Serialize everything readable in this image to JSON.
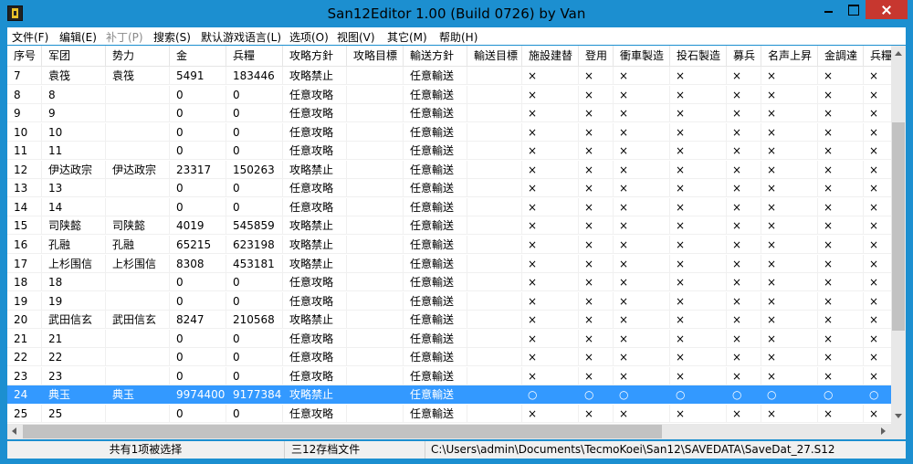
{
  "window": {
    "title": "San12Editor 1.00 (Build 0726) by Van"
  },
  "menu": [
    {
      "label": "文件(F)",
      "enabled": true
    },
    {
      "label": "编辑(E)",
      "enabled": true
    },
    {
      "label": "补丁(P)",
      "enabled": false
    },
    {
      "label": "搜索(S)",
      "enabled": true
    },
    {
      "label": "默认游戏语言(L)",
      "enabled": true
    },
    {
      "label": "选项(O)",
      "enabled": true
    },
    {
      "label": "视图(V)",
      "enabled": true
    },
    {
      "label": "其它(M)",
      "enabled": true
    },
    {
      "label": "帮助(H)",
      "enabled": true
    }
  ],
  "table": {
    "columns": [
      "序号",
      "军团",
      "势力",
      "金",
      "兵糧",
      "攻略方針",
      "攻略目標",
      "輸送方針",
      "輸送目標",
      "施設建替",
      "登用",
      "衝車製造",
      "投石製造",
      "募兵",
      "名声上昇",
      "金調達",
      "兵糧"
    ],
    "selected_row_index": 17,
    "rows": [
      [
        "7",
        "袁筏",
        "袁筏",
        "5491",
        "183446",
        "攻略禁止",
        "",
        "任意輸送",
        "",
        "×",
        "×",
        "×",
        "×",
        "×",
        "×",
        "×",
        "×"
      ],
      [
        "8",
        "8",
        "",
        "0",
        "0",
        "任意攻略",
        "",
        "任意輸送",
        "",
        "×",
        "×",
        "×",
        "×",
        "×",
        "×",
        "×",
        "×"
      ],
      [
        "9",
        "9",
        "",
        "0",
        "0",
        "任意攻略",
        "",
        "任意輸送",
        "",
        "×",
        "×",
        "×",
        "×",
        "×",
        "×",
        "×",
        "×"
      ],
      [
        "10",
        "10",
        "",
        "0",
        "0",
        "任意攻略",
        "",
        "任意輸送",
        "",
        "×",
        "×",
        "×",
        "×",
        "×",
        "×",
        "×",
        "×"
      ],
      [
        "11",
        "11",
        "",
        "0",
        "0",
        "任意攻略",
        "",
        "任意輸送",
        "",
        "×",
        "×",
        "×",
        "×",
        "×",
        "×",
        "×",
        "×"
      ],
      [
        "12",
        "伊达政宗",
        "伊达政宗",
        "23317",
        "150263",
        "攻略禁止",
        "",
        "任意輸送",
        "",
        "×",
        "×",
        "×",
        "×",
        "×",
        "×",
        "×",
        "×"
      ],
      [
        "13",
        "13",
        "",
        "0",
        "0",
        "任意攻略",
        "",
        "任意輸送",
        "",
        "×",
        "×",
        "×",
        "×",
        "×",
        "×",
        "×",
        "×"
      ],
      [
        "14",
        "14",
        "",
        "0",
        "0",
        "任意攻略",
        "",
        "任意輸送",
        "",
        "×",
        "×",
        "×",
        "×",
        "×",
        "×",
        "×",
        "×"
      ],
      [
        "15",
        "司陕懿",
        "司陕懿",
        "4019",
        "545859",
        "攻略禁止",
        "",
        "任意輸送",
        "",
        "×",
        "×",
        "×",
        "×",
        "×",
        "×",
        "×",
        "×"
      ],
      [
        "16",
        "孔融",
        "孔融",
        "65215",
        "623198",
        "攻略禁止",
        "",
        "任意輸送",
        "",
        "×",
        "×",
        "×",
        "×",
        "×",
        "×",
        "×",
        "×"
      ],
      [
        "17",
        "上杉围信",
        "上杉围信",
        "8308",
        "453181",
        "攻略禁止",
        "",
        "任意輸送",
        "",
        "×",
        "×",
        "×",
        "×",
        "×",
        "×",
        "×",
        "×"
      ],
      [
        "18",
        "18",
        "",
        "0",
        "0",
        "任意攻略",
        "",
        "任意輸送",
        "",
        "×",
        "×",
        "×",
        "×",
        "×",
        "×",
        "×",
        "×"
      ],
      [
        "19",
        "19",
        "",
        "0",
        "0",
        "任意攻略",
        "",
        "任意輸送",
        "",
        "×",
        "×",
        "×",
        "×",
        "×",
        "×",
        "×",
        "×"
      ],
      [
        "20",
        "武田信玄",
        "武田信玄",
        "8247",
        "210568",
        "攻略禁止",
        "",
        "任意輸送",
        "",
        "×",
        "×",
        "×",
        "×",
        "×",
        "×",
        "×",
        "×"
      ],
      [
        "21",
        "21",
        "",
        "0",
        "0",
        "任意攻略",
        "",
        "任意輸送",
        "",
        "×",
        "×",
        "×",
        "×",
        "×",
        "×",
        "×",
        "×"
      ],
      [
        "22",
        "22",
        "",
        "0",
        "0",
        "任意攻略",
        "",
        "任意輸送",
        "",
        "×",
        "×",
        "×",
        "×",
        "×",
        "×",
        "×",
        "×"
      ],
      [
        "23",
        "23",
        "",
        "0",
        "0",
        "任意攻略",
        "",
        "任意輸送",
        "",
        "×",
        "×",
        "×",
        "×",
        "×",
        "×",
        "×",
        "×"
      ],
      [
        "24",
        "典玉",
        "典玉",
        "9974400",
        "9177384",
        "攻略禁止",
        "",
        "任意輸送",
        "",
        "○",
        "○",
        "○",
        "○",
        "○",
        "○",
        "○",
        "○"
      ],
      [
        "25",
        "25",
        "",
        "0",
        "0",
        "任意攻略",
        "",
        "任意輸送",
        "",
        "×",
        "×",
        "×",
        "×",
        "×",
        "×",
        "×",
        "×"
      ]
    ]
  },
  "status": {
    "selection": "共有1项被选择",
    "file_type": "三12存档文件",
    "file_path": "C:\\Users\\admin\\Documents\\TecmoKoei\\San12\\SAVEDATA\\SaveDat_27.S12"
  },
  "colors": {
    "title_bar": "#1c8fd0",
    "close_button": "#c7372f",
    "selection": "#3399ff"
  }
}
